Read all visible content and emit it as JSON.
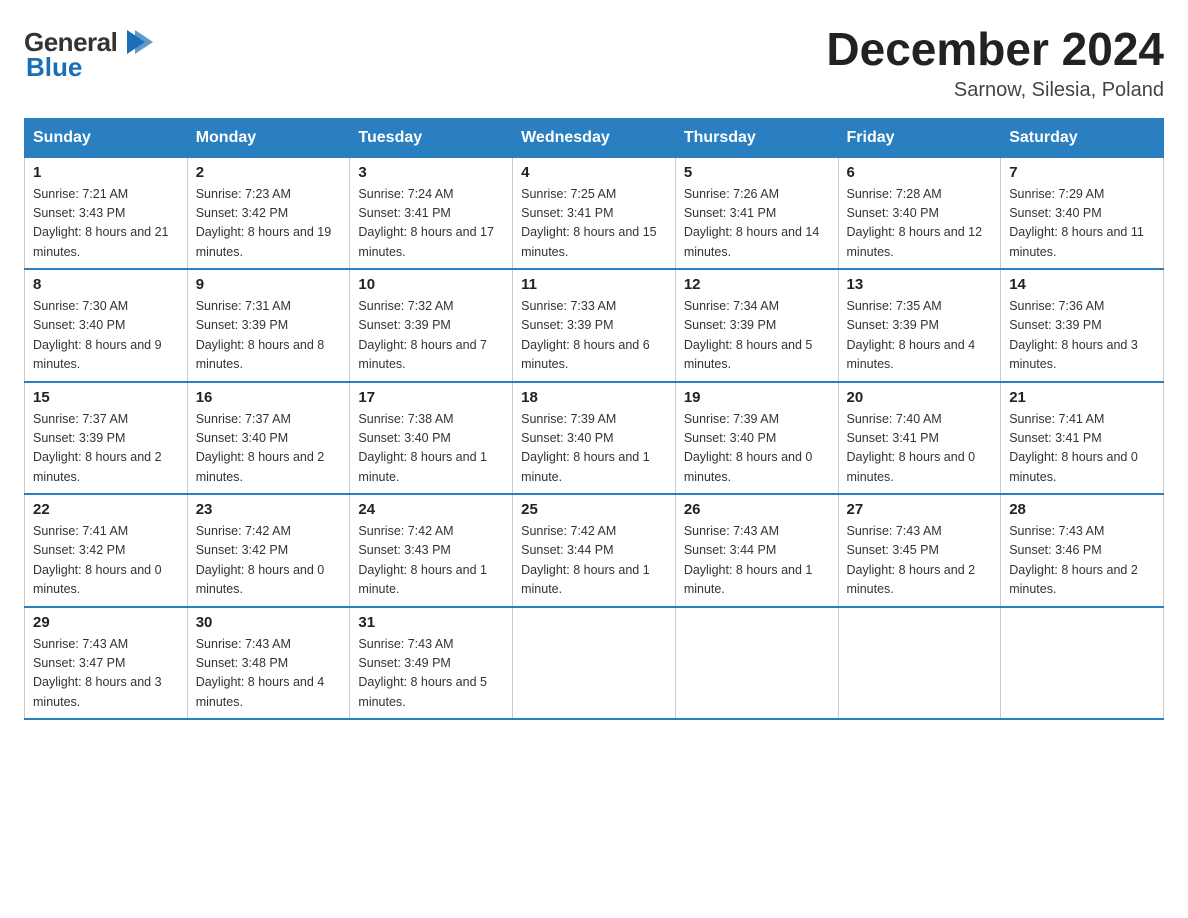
{
  "header": {
    "logo_line1": "General",
    "logo_line2": "Blue",
    "title": "December 2024",
    "subtitle": "Sarnow, Silesia, Poland"
  },
  "days_of_week": [
    "Sunday",
    "Monday",
    "Tuesday",
    "Wednesday",
    "Thursday",
    "Friday",
    "Saturday"
  ],
  "weeks": [
    [
      {
        "day": "1",
        "sunrise": "7:21 AM",
        "sunset": "3:43 PM",
        "daylight": "8 hours and 21 minutes."
      },
      {
        "day": "2",
        "sunrise": "7:23 AM",
        "sunset": "3:42 PM",
        "daylight": "8 hours and 19 minutes."
      },
      {
        "day": "3",
        "sunrise": "7:24 AM",
        "sunset": "3:41 PM",
        "daylight": "8 hours and 17 minutes."
      },
      {
        "day": "4",
        "sunrise": "7:25 AM",
        "sunset": "3:41 PM",
        "daylight": "8 hours and 15 minutes."
      },
      {
        "day": "5",
        "sunrise": "7:26 AM",
        "sunset": "3:41 PM",
        "daylight": "8 hours and 14 minutes."
      },
      {
        "day": "6",
        "sunrise": "7:28 AM",
        "sunset": "3:40 PM",
        "daylight": "8 hours and 12 minutes."
      },
      {
        "day": "7",
        "sunrise": "7:29 AM",
        "sunset": "3:40 PM",
        "daylight": "8 hours and 11 minutes."
      }
    ],
    [
      {
        "day": "8",
        "sunrise": "7:30 AM",
        "sunset": "3:40 PM",
        "daylight": "8 hours and 9 minutes."
      },
      {
        "day": "9",
        "sunrise": "7:31 AM",
        "sunset": "3:39 PM",
        "daylight": "8 hours and 8 minutes."
      },
      {
        "day": "10",
        "sunrise": "7:32 AM",
        "sunset": "3:39 PM",
        "daylight": "8 hours and 7 minutes."
      },
      {
        "day": "11",
        "sunrise": "7:33 AM",
        "sunset": "3:39 PM",
        "daylight": "8 hours and 6 minutes."
      },
      {
        "day": "12",
        "sunrise": "7:34 AM",
        "sunset": "3:39 PM",
        "daylight": "8 hours and 5 minutes."
      },
      {
        "day": "13",
        "sunrise": "7:35 AM",
        "sunset": "3:39 PM",
        "daylight": "8 hours and 4 minutes."
      },
      {
        "day": "14",
        "sunrise": "7:36 AM",
        "sunset": "3:39 PM",
        "daylight": "8 hours and 3 minutes."
      }
    ],
    [
      {
        "day": "15",
        "sunrise": "7:37 AM",
        "sunset": "3:39 PM",
        "daylight": "8 hours and 2 minutes."
      },
      {
        "day": "16",
        "sunrise": "7:37 AM",
        "sunset": "3:40 PM",
        "daylight": "8 hours and 2 minutes."
      },
      {
        "day": "17",
        "sunrise": "7:38 AM",
        "sunset": "3:40 PM",
        "daylight": "8 hours and 1 minute."
      },
      {
        "day": "18",
        "sunrise": "7:39 AM",
        "sunset": "3:40 PM",
        "daylight": "8 hours and 1 minute."
      },
      {
        "day": "19",
        "sunrise": "7:39 AM",
        "sunset": "3:40 PM",
        "daylight": "8 hours and 0 minutes."
      },
      {
        "day": "20",
        "sunrise": "7:40 AM",
        "sunset": "3:41 PM",
        "daylight": "8 hours and 0 minutes."
      },
      {
        "day": "21",
        "sunrise": "7:41 AM",
        "sunset": "3:41 PM",
        "daylight": "8 hours and 0 minutes."
      }
    ],
    [
      {
        "day": "22",
        "sunrise": "7:41 AM",
        "sunset": "3:42 PM",
        "daylight": "8 hours and 0 minutes."
      },
      {
        "day": "23",
        "sunrise": "7:42 AM",
        "sunset": "3:42 PM",
        "daylight": "8 hours and 0 minutes."
      },
      {
        "day": "24",
        "sunrise": "7:42 AM",
        "sunset": "3:43 PM",
        "daylight": "8 hours and 1 minute."
      },
      {
        "day": "25",
        "sunrise": "7:42 AM",
        "sunset": "3:44 PM",
        "daylight": "8 hours and 1 minute."
      },
      {
        "day": "26",
        "sunrise": "7:43 AM",
        "sunset": "3:44 PM",
        "daylight": "8 hours and 1 minute."
      },
      {
        "day": "27",
        "sunrise": "7:43 AM",
        "sunset": "3:45 PM",
        "daylight": "8 hours and 2 minutes."
      },
      {
        "day": "28",
        "sunrise": "7:43 AM",
        "sunset": "3:46 PM",
        "daylight": "8 hours and 2 minutes."
      }
    ],
    [
      {
        "day": "29",
        "sunrise": "7:43 AM",
        "sunset": "3:47 PM",
        "daylight": "8 hours and 3 minutes."
      },
      {
        "day": "30",
        "sunrise": "7:43 AM",
        "sunset": "3:48 PM",
        "daylight": "8 hours and 4 minutes."
      },
      {
        "day": "31",
        "sunrise": "7:43 AM",
        "sunset": "3:49 PM",
        "daylight": "8 hours and 5 minutes."
      },
      null,
      null,
      null,
      null
    ]
  ]
}
